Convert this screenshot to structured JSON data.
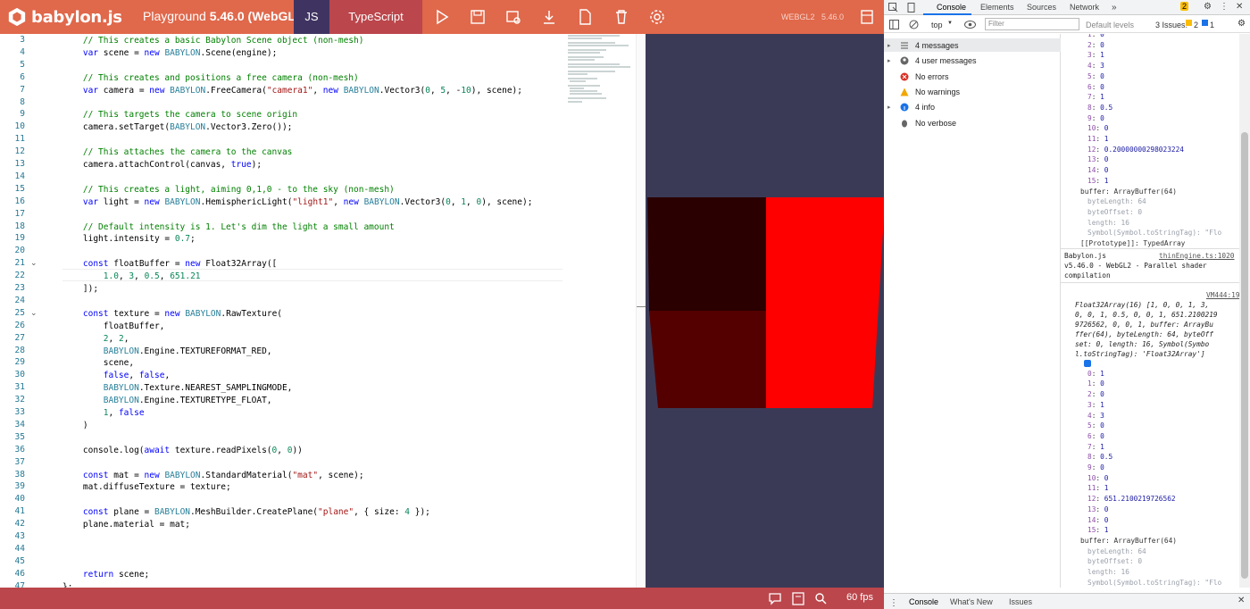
{
  "topbar": {
    "logo_text": "babylon.js",
    "playground_label": "Playground",
    "version_label": "5.46.0 (WebGL2)",
    "tab_js": "JS",
    "tab_ts": "TypeScript",
    "engine_label": "WEBGL2",
    "engine_version": "5.46.0"
  },
  "editor": {
    "line_numbers": [
      "3",
      "4",
      "5",
      "6",
      "7",
      "8",
      "9",
      "10",
      "11",
      "12",
      "13",
      "14",
      "15",
      "16",
      "17",
      "18",
      "19",
      "20",
      "21",
      "22",
      "23",
      "24",
      "25",
      "26",
      "27",
      "28",
      "29",
      "30",
      "31",
      "32",
      "33",
      "34",
      "35",
      "36",
      "37",
      "38",
      "39",
      "40",
      "41",
      "42",
      "43",
      "44",
      "45",
      "46",
      "47"
    ],
    "lines": [
      "    // This creates a basic Babylon Scene object (non-mesh)",
      "    var scene = new BABYLON.Scene(engine);",
      "",
      "    // This creates and positions a free camera (non-mesh)",
      "    var camera = new BABYLON.FreeCamera(\"camera1\", new BABYLON.Vector3(0, 5, -10), scene);",
      "",
      "    // This targets the camera to scene origin",
      "    camera.setTarget(BABYLON.Vector3.Zero());",
      "",
      "    // This attaches the camera to the canvas",
      "    camera.attachControl(canvas, true);",
      "",
      "    // This creates a light, aiming 0,1,0 - to the sky (non-mesh)",
      "    var light = new BABYLON.HemisphericLight(\"light1\", new BABYLON.Vector3(0, 1, 0), scene);",
      "",
      "    // Default intensity is 1. Let's dim the light a small amount",
      "    light.intensity = 0.7;",
      "",
      "    const floatBuffer = new Float32Array([",
      "        1.0, 3, 0.5, 651.21",
      "    ]);",
      "",
      "    const texture = new BABYLON.RawTexture(",
      "        floatBuffer,",
      "        2, 2,",
      "        BABYLON.Engine.TEXTUREFORMAT_RED,",
      "        scene,",
      "        false, false,",
      "        BABYLON.Texture.NEAREST_SAMPLINGMODE,",
      "        BABYLON.Engine.TEXTURETYPE_FLOAT,",
      "        1, false",
      "    )",
      "",
      "    console.log(await texture.readPixels(0, 0))",
      "",
      "    const mat = new BABYLON.StandardMaterial(\"mat\", scene);",
      "    mat.diffuseTexture = texture;",
      "",
      "    const plane = BABYLON.MeshBuilder.CreatePlane(\"plane\", { size: 4 });",
      "    plane.material = mat;",
      "",
      "",
      "",
      "    return scene;",
      "};"
    ]
  },
  "bottombar": {
    "fps": "60 fps"
  },
  "devtools": {
    "tabs": [
      "Console",
      "Elements",
      "Sources",
      "Network"
    ],
    "context": "top",
    "filter_placeholder": "Filter",
    "default_levels": "Default levels",
    "issues_label": "3 Issues:",
    "issues_warn": "2",
    "issues_info": "1",
    "badge_count": "2",
    "sidebar": [
      {
        "label": "4 messages",
        "icon": "list-icon"
      },
      {
        "label": "4 user messages",
        "icon": "user-icon"
      },
      {
        "label": "No errors",
        "icon": "error-icon"
      },
      {
        "label": "No warnings",
        "icon": "warning-icon"
      },
      {
        "label": "4 info",
        "icon": "info-icon"
      },
      {
        "label": "No verbose",
        "icon": "bug-icon"
      }
    ],
    "array_top": [
      {
        "i": "1",
        "v": "0"
      },
      {
        "i": "2",
        "v": "0"
      },
      {
        "i": "3",
        "v": "1"
      },
      {
        "i": "4",
        "v": "3"
      },
      {
        "i": "5",
        "v": "0"
      },
      {
        "i": "6",
        "v": "0"
      },
      {
        "i": "7",
        "v": "1"
      },
      {
        "i": "8",
        "v": "0.5"
      },
      {
        "i": "9",
        "v": "0"
      },
      {
        "i": "10",
        "v": "0"
      },
      {
        "i": "11",
        "v": "1"
      },
      {
        "i": "12",
        "v": "0.20000000298023224"
      },
      {
        "i": "13",
        "v": "0"
      },
      {
        "i": "14",
        "v": "0"
      },
      {
        "i": "15",
        "v": "1"
      }
    ],
    "props_top": {
      "buffer": "buffer: ArrayBuffer(64)",
      "byteLength": "byteLength: 64",
      "byteOffset": "byteOffset: 0",
      "length": "length: 16",
      "symbol": "Symbol(Symbol.toStringTag): \"Flo",
      "proto": "[[Prototype]]: TypedArray"
    },
    "babylon_msg": {
      "name": "Babylon.js",
      "link": "thinEngine.ts:1020",
      "line1": "v5.46.0 - WebGL2 - Parallel shader",
      "line2": "compilation"
    },
    "vm_link": "VM444:19",
    "summary": [
      "Float32Array(16) [1, 0, 0, 1, 3,",
      "0, 0, 1, 0.5, 0, 0, 1, 651.2100219",
      "9726562, 0, 0, 1, buffer: ArrayBu",
      "ffer(64), byteLength: 64, byteOff",
      "set: 0, length: 16, Symbol(Symbo",
      "l.toStringTag): 'Float32Array']"
    ],
    "array_bottom": [
      {
        "i": "0",
        "v": "1"
      },
      {
        "i": "1",
        "v": "0"
      },
      {
        "i": "2",
        "v": "0"
      },
      {
        "i": "3",
        "v": "1"
      },
      {
        "i": "4",
        "v": "3"
      },
      {
        "i": "5",
        "v": "0"
      },
      {
        "i": "6",
        "v": "0"
      },
      {
        "i": "7",
        "v": "1"
      },
      {
        "i": "8",
        "v": "0.5"
      },
      {
        "i": "9",
        "v": "0"
      },
      {
        "i": "10",
        "v": "0"
      },
      {
        "i": "11",
        "v": "1"
      },
      {
        "i": "12",
        "v": "651.2100219726562"
      },
      {
        "i": "13",
        "v": "0"
      },
      {
        "i": "14",
        "v": "0"
      },
      {
        "i": "15",
        "v": "1"
      }
    ],
    "props_bottom": {
      "buffer": "buffer: ArrayBuffer(64)",
      "byteLength": "byteLength: 64",
      "byteOffset": "byteOffset: 0",
      "length": "length: 16",
      "symbol": "Symbol(Symbol.toStringTag): \"Flo",
      "proto": "[[Prototype]]: TypedArray"
    },
    "bottom_tabs": [
      "Console",
      "What's New",
      "Issues"
    ]
  },
  "colors": {
    "topbar": "#e0684b",
    "js_tab": "#3f3461",
    "ts_tab": "#bb464b",
    "render_bg": "#3b3a56",
    "quad_top_left": "#2a0000",
    "quad_bottom_left": "#550000",
    "quad_right": "#ff0000"
  }
}
